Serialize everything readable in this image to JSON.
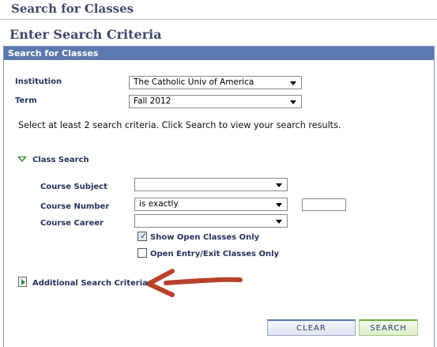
{
  "page": {
    "title": "Search for Classes",
    "subtitle": "Enter Search Criteria",
    "panel_title": "Search for Classes"
  },
  "form": {
    "institution_label": "Institution",
    "institution_value": "The Catholic Univ of America",
    "term_label": "Term",
    "term_value": "Fall 2012",
    "instructions": "Select at least 2 search criteria. Click Search to view your search results."
  },
  "class_search": {
    "section_label": "Class Search",
    "course_subject_label": "Course Subject",
    "course_subject_value": "",
    "course_number_label": "Course Number",
    "course_number_operator": "is exactly",
    "course_number_value": "",
    "course_career_label": "Course Career",
    "course_career_value": "",
    "show_open_label": "Show Open Classes Only",
    "show_open_checked": true,
    "open_entry_label": "Open Entry/Exit Classes Only",
    "open_entry_checked": false
  },
  "additional": {
    "label": "Additional Search Criteria"
  },
  "buttons": {
    "clear": "CLEAR",
    "search": "SEARCH"
  },
  "colors": {
    "header_blue": "#5b79ae",
    "title_text": "#3f4a6a",
    "expand_green": "#2e8b2e",
    "annotation_arrow": "#b8412b"
  }
}
